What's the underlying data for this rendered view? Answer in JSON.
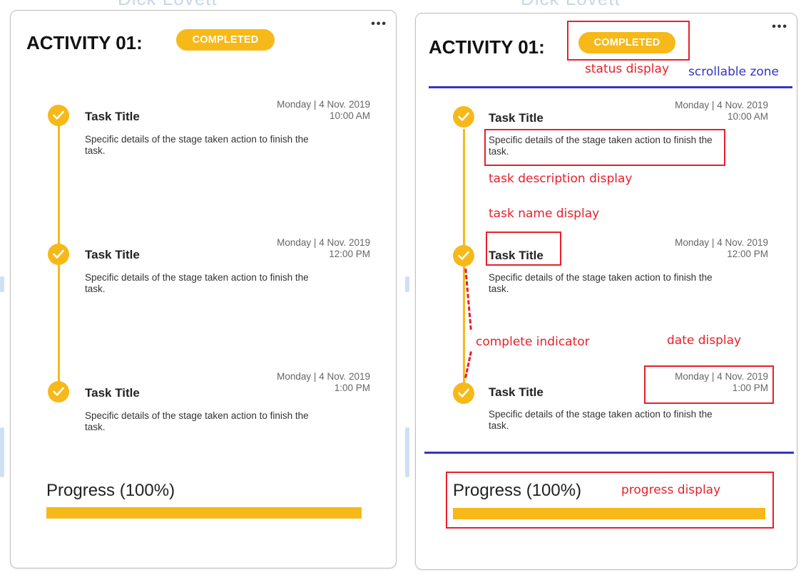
{
  "colors": {
    "accent": "#f6b919",
    "annotation_red": "#e8202a",
    "annotation_blue": "#3434c8"
  },
  "activity": {
    "title": "ACTIVITY 01:",
    "status": "COMPLETED",
    "more_icon": "more-horizontal-icon"
  },
  "tasks": [
    {
      "title": "Task Title",
      "description": "Specific details of the stage taken action to finish the task.",
      "date": "Monday | 4 Nov. 2019",
      "time": "10:00 AM",
      "icon": "check-circle-icon"
    },
    {
      "title": "Task Title",
      "description": "Specific details of the stage taken action to finish the task.",
      "date": "Monday | 4 Nov. 2019",
      "time": "12:00 PM",
      "icon": "check-circle-icon"
    },
    {
      "title": "Task Title",
      "description": "Specific details of the stage taken action to finish the task.",
      "date": "Monday | 4 Nov. 2019",
      "time": "1:00 PM",
      "icon": "check-circle-icon"
    }
  ],
  "progress": {
    "label": "Progress",
    "percent_text": "(100%)",
    "value": 1.0
  },
  "annotations": {
    "status_display": "status display",
    "scrollable_zone": "scrollable zone",
    "task_description_display": "task description display",
    "task_name_display": "task name display",
    "complete_indicator": "complete indicator",
    "date_display": "date display",
    "progress_display": "progress display"
  }
}
